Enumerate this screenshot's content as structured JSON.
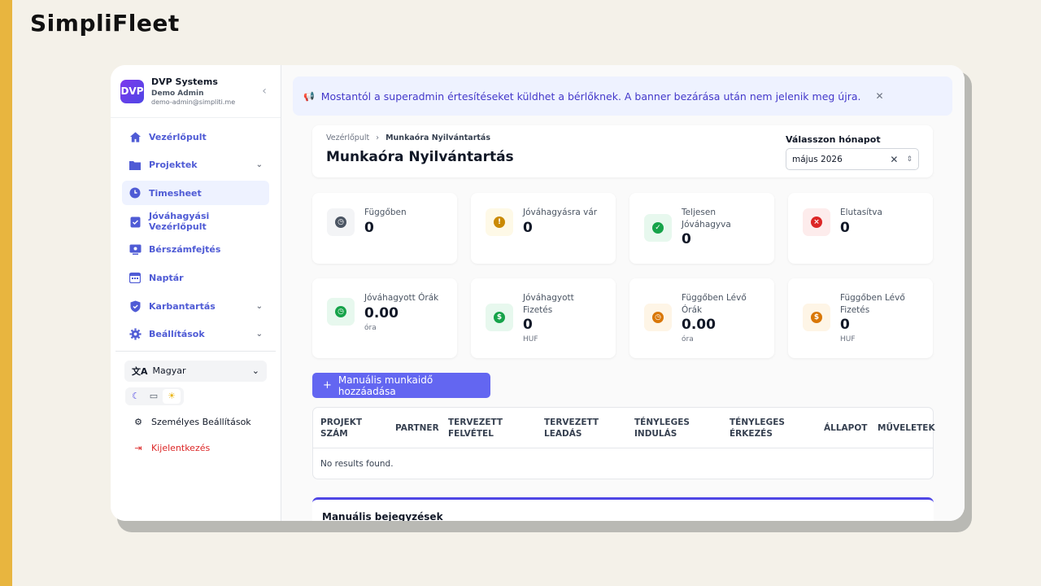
{
  "brand": "SimpliFleet",
  "org": {
    "logo_text": "DVP",
    "name": "DVP Systems",
    "user": "Demo Admin",
    "email": "demo-admin@simpliti.me"
  },
  "nav": [
    {
      "label": "Vezérlőpult",
      "icon": "home-icon",
      "chevron": false,
      "active": false
    },
    {
      "label": "Projektek",
      "icon": "folder-icon",
      "chevron": true,
      "active": false
    },
    {
      "label": "Timesheet",
      "icon": "clock-icon",
      "chevron": false,
      "active": true
    },
    {
      "label": "Jóváhagyási Vezérlőpult",
      "icon": "clipboard-check-icon",
      "chevron": false,
      "active": false
    },
    {
      "label": "Bérszámfejtés",
      "icon": "payroll-icon",
      "chevron": false,
      "active": false
    },
    {
      "label": "Naptár",
      "icon": "calendar-icon",
      "chevron": false,
      "active": false
    },
    {
      "label": "Karbantartás",
      "icon": "shield-icon",
      "chevron": true,
      "active": false
    },
    {
      "label": "Beállítások",
      "icon": "gear-icon",
      "chevron": true,
      "active": false
    }
  ],
  "language": "Magyar",
  "personal_settings": "Személyes Beállítások",
  "logout": "Kijelentkezés",
  "banner": {
    "text": "Mostantól a superadmin értesítéseket küldhet a bérlőknek. A banner bezárása után nem jelenik meg újra."
  },
  "breadcrumb": {
    "parent": "Vezérlőpult",
    "current": "Munkaóra Nyilvántartás"
  },
  "page_title": "Munkaóra Nyilvántartás",
  "month": {
    "label": "Válasszon hónapot",
    "value": "május 2026"
  },
  "stats": [
    {
      "label": "Függőben",
      "value": "0",
      "unit": "",
      "color": "#4b5563",
      "bg": "#f3f4f6",
      "icon": "clock-icon"
    },
    {
      "label": "Jóváhagyásra vár",
      "value": "0",
      "unit": "",
      "color": "#ca8a04",
      "bg": "#fef9e7",
      "icon": "exclamation-icon"
    },
    {
      "label": "Teljesen Jóváhagyva",
      "value": "0",
      "unit": "",
      "color": "#16a34a",
      "bg": "#e7f8ee",
      "icon": "check-icon"
    },
    {
      "label": "Elutasítva",
      "value": "0",
      "unit": "",
      "color": "#dc2626",
      "bg": "#fdecec",
      "icon": "x-circle-icon"
    },
    {
      "label": "Jóváhagyott Órák",
      "value": "0.00",
      "unit": "óra",
      "color": "#16a34a",
      "bg": "#e7f8ee",
      "icon": "clock-icon"
    },
    {
      "label": "Jóváhagyott Fizetés",
      "value": "0",
      "unit": "HUF",
      "color": "#16a34a",
      "bg": "#e7f8ee",
      "icon": "dollar-icon"
    },
    {
      "label": "Függőben Lévő Órák",
      "value": "0.00",
      "unit": "óra",
      "color": "#d97706",
      "bg": "#fef5e6",
      "icon": "clock-icon"
    },
    {
      "label": "Függőben Lévő Fizetés",
      "value": "0",
      "unit": "HUF",
      "color": "#d97706",
      "bg": "#fef5e6",
      "icon": "dollar-icon"
    }
  ],
  "add_button": "Manuális munkaidő hozzáadása",
  "table": {
    "headers": [
      "PROJEKT SZÁM",
      "PARTNER",
      "TERVEZETT FELVÉTEL",
      "TERVEZETT LEADÁS",
      "TÉNYLEGES INDULÁS",
      "TÉNYLEGES ÉRKEZÉS",
      "ÁLLAPOT",
      "MŰVELETEK"
    ],
    "empty": "No results found."
  },
  "manual_entries_title": "Manuális bejegyzések",
  "colors": {
    "accent": "#6366f1",
    "danger": "#dc2626"
  }
}
